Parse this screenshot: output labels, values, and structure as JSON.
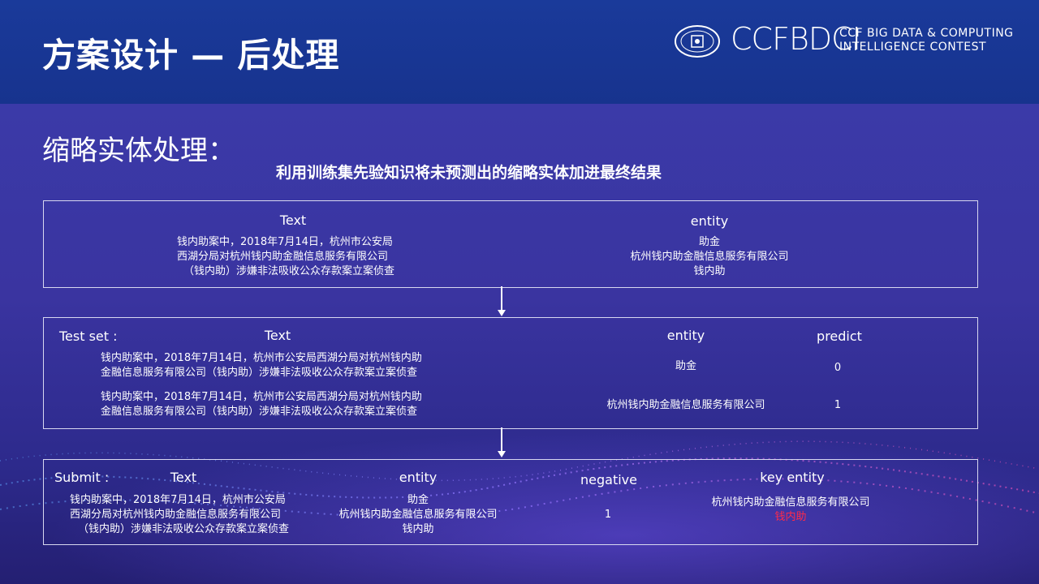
{
  "header": {
    "title": "方案设计 — 后处理",
    "logo": {
      "ccf": "CCF",
      "bdci": "BDCI",
      "text_line1": "CCF BIG DATA & COMPUTING",
      "text_line2": "INTELLIGENCE CONTEST",
      "seal": "中国计算机学会 CCF"
    }
  },
  "section": {
    "title": "缩略实体处理：",
    "subtitle": "利用训练集先验知识将未预测出的缩略实体加进最终结果"
  },
  "chart_data": {
    "type": "table",
    "tables": [
      {
        "label": "",
        "columns": [
          "Text",
          "entity"
        ],
        "rows": [
          {
            "text": [
              "钱内助案中，2018年7月14日，杭州市公安局",
              "西湖分局对杭州钱内助金融信息服务有限公司",
              "（钱内助）涉嫌非法吸收公众存款案立案侦查"
            ],
            "entity": [
              "助金",
              "杭州钱内助金融信息服务有限公司",
              "钱内助"
            ]
          }
        ]
      },
      {
        "label": "Test set :",
        "columns": [
          "Text",
          "entity",
          "predict"
        ],
        "rows": [
          {
            "text": [
              "钱内助案中，2018年7月14日，杭州市公安局西湖分局对杭州钱内助",
              "金融信息服务有限公司（钱内助）涉嫌非法吸收公众存款案立案侦查"
            ],
            "entity": "助金",
            "predict": "0"
          },
          {
            "text": [
              "钱内助案中，2018年7月14日，杭州市公安局西湖分局对杭州钱内助",
              "金融信息服务有限公司（钱内助）涉嫌非法吸收公众存款案立案侦查"
            ],
            "entity": "杭州钱内助金融信息服务有限公司",
            "predict": "1"
          }
        ]
      },
      {
        "label": "Submit :",
        "columns": [
          "Text",
          "entity",
          "negative",
          "key entity"
        ],
        "rows": [
          {
            "text": [
              "钱内助案中，2018年7月14日，杭州市公安局",
              "西湖分局对杭州钱内助金融信息服务有限公司",
              "（钱内助）涉嫌非法吸收公众存款案立案侦查"
            ],
            "entity": [
              "助金",
              "杭州钱内助金融信息服务有限公司",
              "钱内助"
            ],
            "negative": "1",
            "key_entity": [
              "杭州钱内助金融信息服务有限公司",
              "钱内助"
            ]
          }
        ]
      }
    ]
  },
  "colors": {
    "highlight": "#ff2a4a",
    "background": "#3a34a0",
    "header": "#1a3a9a"
  }
}
